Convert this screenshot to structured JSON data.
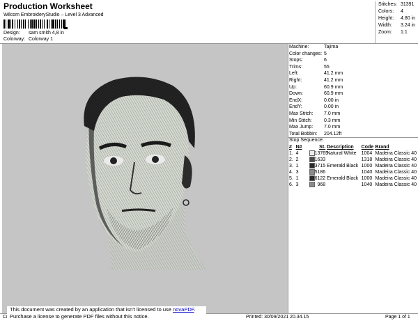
{
  "header": {
    "title": "Production Worksheet",
    "subtitle": "Wilcom EmbroideryStudio – Level 3 Advanced",
    "design_label": "Design:",
    "design_value": "sam smith 4,8 in",
    "colorway_label": "Colorway:",
    "colorway_value": "Colorway 1"
  },
  "stats": [
    {
      "label": "Stitches:",
      "value": "31391"
    },
    {
      "label": "Colors:",
      "value": "4"
    },
    {
      "label": "Height:",
      "value": "4.80 in"
    },
    {
      "label": "Width:",
      "value": "3.24 in"
    },
    {
      "label": "Zoom:",
      "value": "1:1"
    }
  ],
  "machine_info": [
    {
      "label": "Machine:",
      "value": "Tajima"
    },
    {
      "label": "Color changes:",
      "value": "5"
    },
    {
      "label": "Stops:",
      "value": "6"
    },
    {
      "label": "Trims:",
      "value": "55"
    },
    {
      "label": "Left:",
      "value": "41.2 mm"
    },
    {
      "label": "Right:",
      "value": "41.2 mm"
    },
    {
      "label": "Up:",
      "value": "60.9 mm"
    },
    {
      "label": "Down:",
      "value": "60.9 mm"
    },
    {
      "label": "EndX:",
      "value": "0.00 in"
    },
    {
      "label": "EndY:",
      "value": "0.00 in"
    },
    {
      "label": "Max Stitch:",
      "value": "7.0 mm"
    },
    {
      "label": "Min Stitch:",
      "value": "0.3 mm"
    },
    {
      "label": "Max Jump:",
      "value": "7.0 mm"
    },
    {
      "label": "Total Bobbin:",
      "value": "204.12ft"
    }
  ],
  "stop_sequence": {
    "title": "Stop Sequence:",
    "columns": [
      "#",
      "N#",
      "St.",
      "Description",
      "Code",
      "Brand"
    ],
    "rows": [
      {
        "idx": "1.",
        "n": "4",
        "color": "#ececec",
        "st": "13765",
        "desc": "Natural White",
        "code": "1004",
        "brand": "Madeira Classic 40"
      },
      {
        "idx": "2.",
        "n": "2",
        "color": "#4a4a4a",
        "st": "1633",
        "desc": "",
        "code": "1318",
        "brand": "Madeira Classic 40"
      },
      {
        "idx": "3.",
        "n": "1",
        "color": "#2b2b2b",
        "st": "3715",
        "desc": "Emerald Black",
        "code": "1000",
        "brand": "Madeira Classic 40"
      },
      {
        "idx": "4.",
        "n": "3",
        "color": "#8a8a8a",
        "st": "5186",
        "desc": "",
        "code": "1040",
        "brand": "Madeira Classic 40"
      },
      {
        "idx": "5.",
        "n": "1",
        "color": "#2b2b2b",
        "st": "6122",
        "desc": "Emerald Black",
        "code": "1000",
        "brand": "Madeira Classic 40"
      },
      {
        "idx": "6.",
        "n": "3",
        "color": "#8a8a8a",
        "st": "968",
        "desc": "",
        "code": "1040",
        "brand": "Madeira Classic 40"
      }
    ]
  },
  "notice": {
    "line1_prefix": "This document was created by an application that isn't licensed to use ",
    "link": "novaPDF",
    "line1_suffix": ".",
    "line2": "Purchase a license to generate PDF files without this notice."
  },
  "footer": {
    "cr": "Cr",
    "printed": "Printed: 30/09/2021 20.34.15",
    "page": "Page 1 of 1"
  }
}
